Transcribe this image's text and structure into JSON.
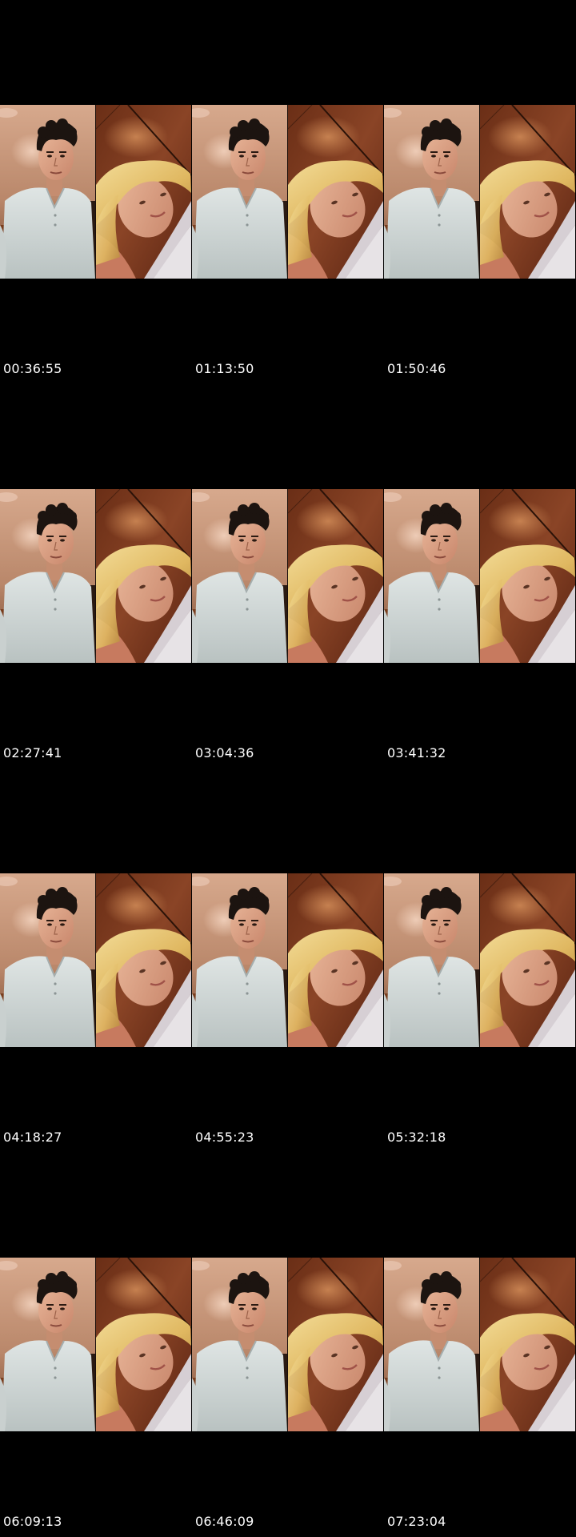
{
  "contact_sheet": {
    "frames": [
      {
        "timestamp": "00:36:55"
      },
      {
        "timestamp": "01:13:50"
      },
      {
        "timestamp": "01:50:46"
      },
      {
        "timestamp": "02:27:41"
      },
      {
        "timestamp": "03:04:36"
      },
      {
        "timestamp": "03:41:32"
      },
      {
        "timestamp": "04:18:27"
      },
      {
        "timestamp": "04:55:23"
      },
      {
        "timestamp": "05:32:18"
      },
      {
        "timestamp": "06:09:13"
      },
      {
        "timestamp": "06:46:09"
      },
      {
        "timestamp": "07:23:04"
      }
    ]
  },
  "colors": {
    "background": "#000000",
    "timestamp_text": "#ffffff",
    "left_wall": "#c99a7e",
    "right_wall": "#7a3a1f",
    "shirt": "#cfd6d6",
    "hair_dark": "#1c1410",
    "hair_blonde": "#e8c777",
    "skin": "#d9a98c"
  }
}
